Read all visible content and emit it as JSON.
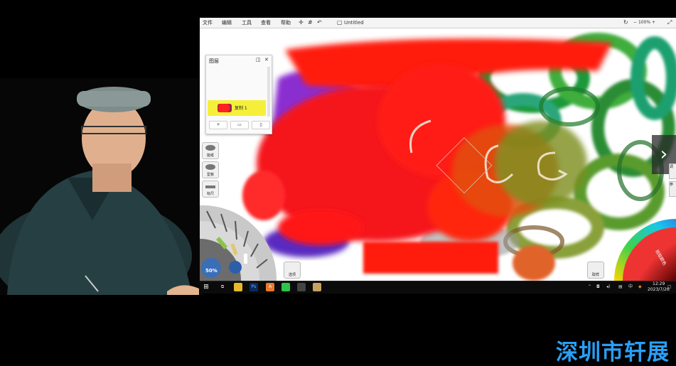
{
  "app": {
    "menu": [
      "文件",
      "编辑",
      "工具",
      "查看",
      "帮助"
    ],
    "doc_title": "Untitled",
    "zoom_control": "100%",
    "toolbar_icons": [
      "transform-icon",
      "grid-icon",
      "undo-icon"
    ]
  },
  "layers_panel": {
    "title": "图层",
    "layer_name": "复制 1",
    "buttons": [
      "+",
      "folder",
      "trash"
    ]
  },
  "side_tools": [
    {
      "label": "能纸",
      "icon": "paper-icon"
    },
    {
      "label": "型板",
      "icon": "template-icon"
    },
    {
      "label": "标尺",
      "icon": "ruler-icon"
    }
  ],
  "brush_wheel": {
    "zoom_label": "50%"
  },
  "tray_button": "选项",
  "palette_button": "取样",
  "color_wheel_label": "拾取颜色",
  "right_tools": [
    "调",
    "参"
  ],
  "taskbar": {
    "apps": [
      "start",
      "task-view",
      "explorer",
      "photoshop",
      "artrage",
      "wechat",
      "paint",
      "app"
    ],
    "tray_text": [
      "中"
    ],
    "time": "12:29",
    "date": "2023/7/26"
  },
  "watermark": "深圳市轩展"
}
